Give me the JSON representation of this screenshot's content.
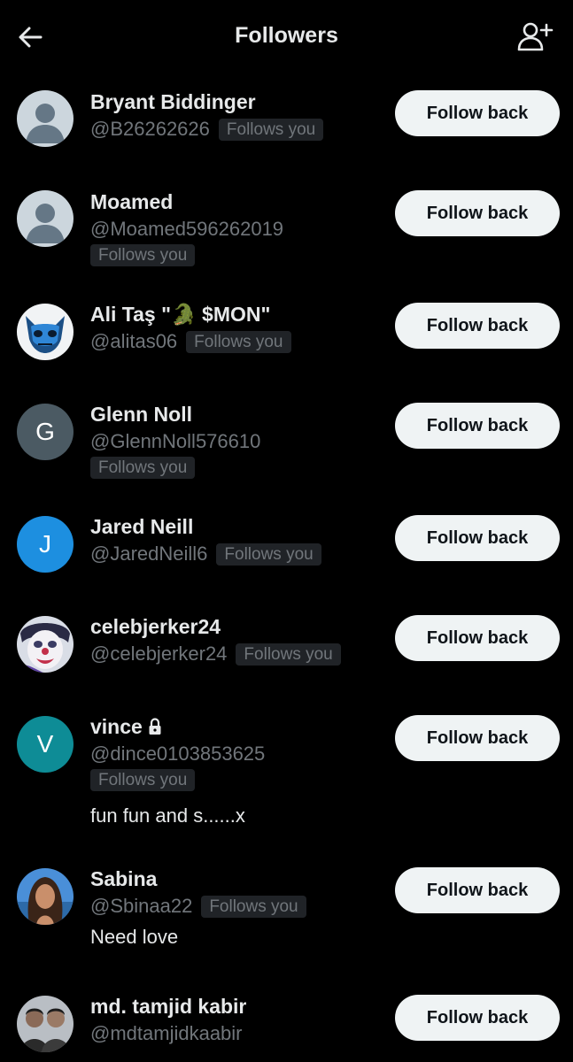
{
  "header": {
    "title": "Followers"
  },
  "follow_label": "Follow back",
  "follows_you": "Follows you",
  "followers": [
    {
      "name": "Bryant Biddinger",
      "handle": "@B26262626",
      "avatar": "default-avatar"
    },
    {
      "name": "Moamed",
      "handle": "@Moamed596262019",
      "avatar": "default-avatar"
    },
    {
      "name": "Ali Taş \"🐊 $MON\"",
      "handle": "@alitas06",
      "avatar": "blue-cat-mask"
    },
    {
      "name": "Glenn Noll",
      "handle": "@GlennNoll576610",
      "avatar_letter": "G",
      "avatar_color": "#4b5a63"
    },
    {
      "name": "Jared Neill",
      "handle": "@JaredNeill6",
      "avatar_letter": "J",
      "avatar_color": "#1d8fe0"
    },
    {
      "name": "celebjerker24",
      "handle": "@celebjerker24",
      "avatar": "clown-photo"
    },
    {
      "name": "vince",
      "handle": "@dince0103853625",
      "avatar_letter": "V",
      "avatar_color": "#0e8c96",
      "protected": true,
      "bio": "fun fun and s......x"
    },
    {
      "name": "Sabina",
      "handle": "@Sbinaa22",
      "avatar": "woman-photo",
      "bio": "Need love"
    },
    {
      "name": "md. tamjid kabir",
      "handle": "@mdtamjidkaabir",
      "avatar": "two-men-photo"
    }
  ]
}
